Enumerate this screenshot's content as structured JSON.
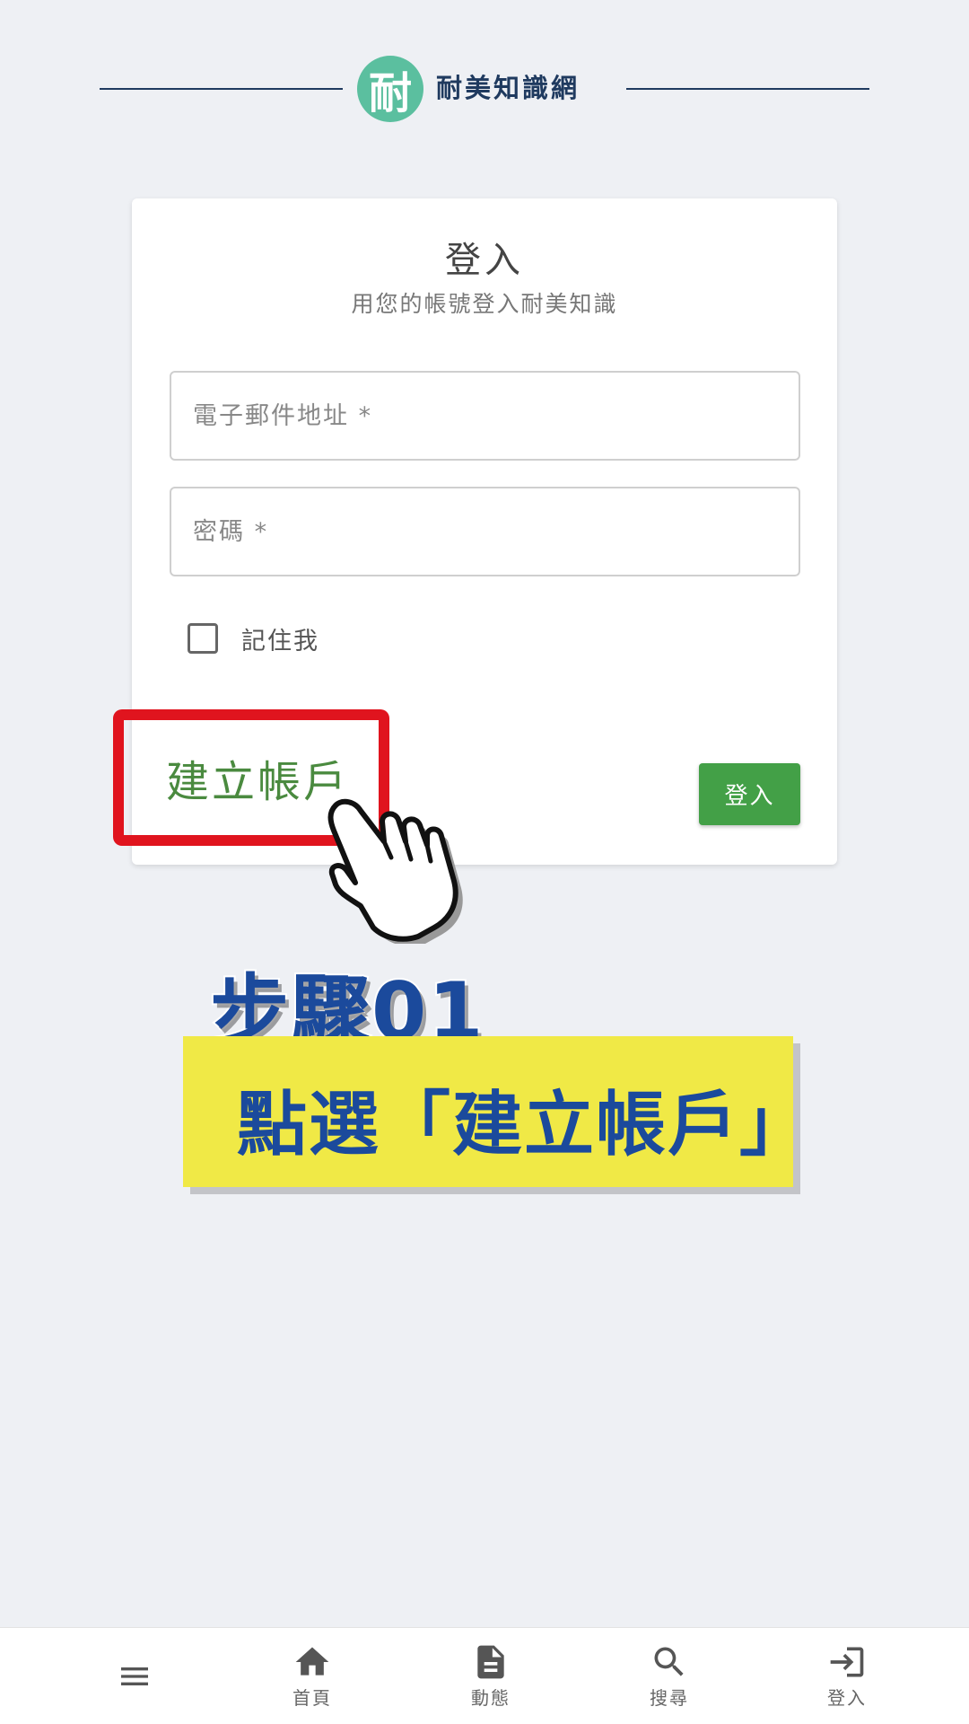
{
  "header": {
    "logo_glyph": "耐",
    "site_name": "耐美知識網",
    "logo_color": "#5bbf9f",
    "name_color": "#1f3a5f"
  },
  "login_card": {
    "title": "登入",
    "subtitle": "用您的帳號登入耐美知識",
    "email_placeholder": "電子郵件地址 *",
    "password_placeholder": "密碼 *",
    "remember_label": "記住我",
    "create_account_label": "建立帳戶",
    "login_button_label": "登入",
    "accent_color": "#43a047"
  },
  "annotation": {
    "step_title": "步驟01",
    "step_text": "點選「建立帳戶」",
    "highlight_color": "#e0141e",
    "banner_color": "#f0e946",
    "text_color": "#1b4a9c"
  },
  "bottom_nav": {
    "items": [
      {
        "icon": "menu-icon",
        "label": ""
      },
      {
        "icon": "home-icon",
        "label": "首頁"
      },
      {
        "icon": "document-icon",
        "label": "動態"
      },
      {
        "icon": "search-icon",
        "label": "搜尋"
      },
      {
        "icon": "login-icon",
        "label": "登入"
      }
    ]
  }
}
